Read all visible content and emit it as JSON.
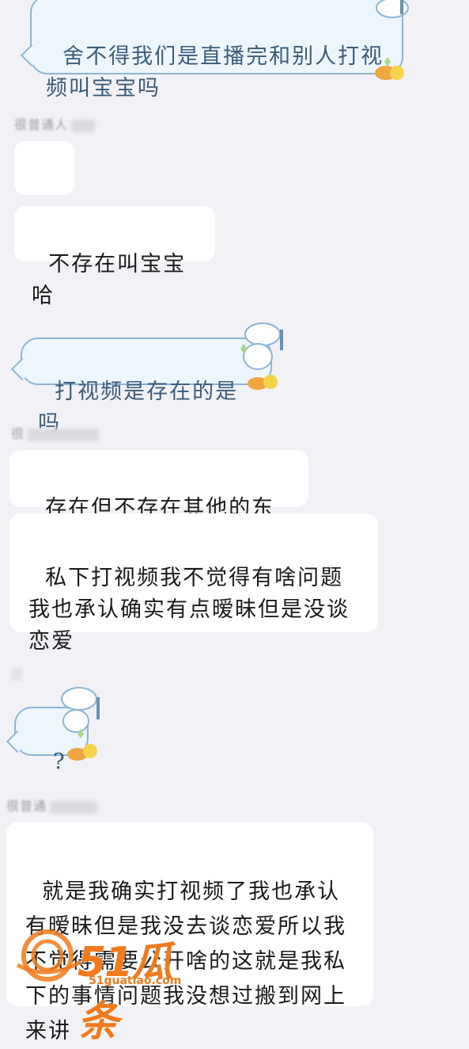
{
  "chat": {
    "msg1": "舍不得我们是直播完和别人打视频叫宝宝吗",
    "sender1": "很普通人",
    "msg2": "?",
    "msg3": "不存在叫宝宝哈",
    "msg4": "打视频是存在的是吗",
    "sender2": "很",
    "msg5": "存在但不存在其他的东西",
    "msg6": "私下打视频我不觉得有啥问题我也承认确实有点暧昧但是没谈恋爱",
    "msg7": "?",
    "sender3": "很普通",
    "msg8": "就是我确实打视频了我也承认有暧昧但是我没去谈恋爱所以我不觉得需要公开啥的这就是我私下的事情问题我没想过搬到网上来讲"
  },
  "watermark": {
    "brand": "51瓜条",
    "url": "51guatiao.com"
  },
  "colors": {
    "background": "#f2f2f6",
    "themed_bubble": "#eef6fd",
    "themed_border": "#8db4d6",
    "watermark": "#f07a1c"
  }
}
